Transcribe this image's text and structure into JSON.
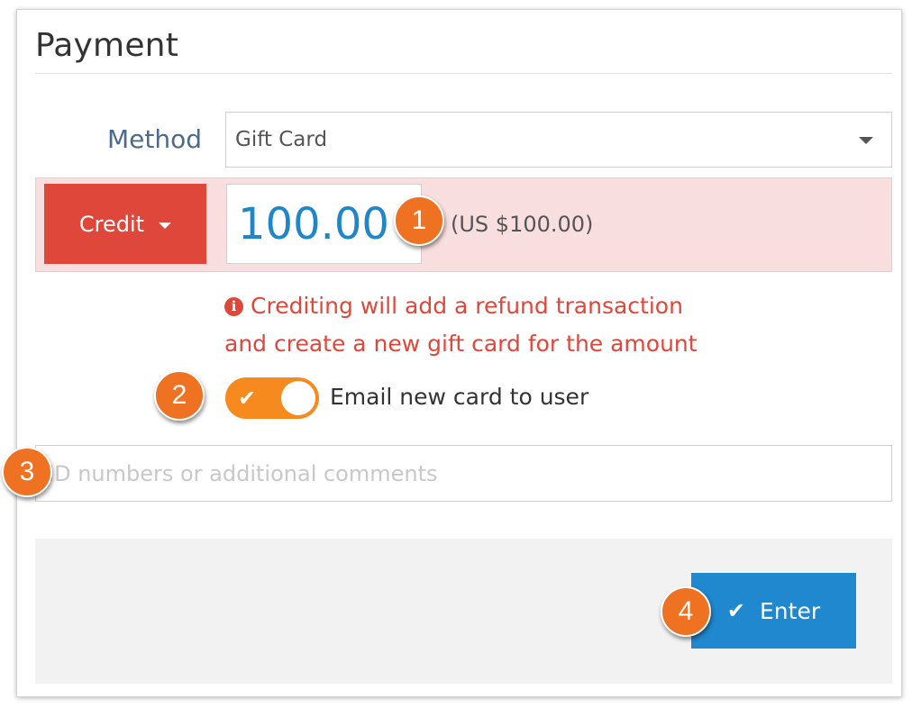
{
  "header": {
    "title": "Payment"
  },
  "method": {
    "label": "Method",
    "selected": "Gift Card"
  },
  "amount": {
    "type_button_label": "Credit",
    "value": "100.00",
    "converted": "(US $100.00)"
  },
  "warning": {
    "icon": "info-icon",
    "line1": "Crediting will add a refund transaction",
    "line2": "and create a new gift card for the amount"
  },
  "email_toggle": {
    "label": "Email new card to user",
    "on": true
  },
  "comments": {
    "placeholder": "ID numbers or additional comments",
    "value": ""
  },
  "footer": {
    "enter_label": "Enter"
  },
  "callouts": [
    "1",
    "2",
    "3",
    "4"
  ],
  "colors": {
    "accent_orange": "#ee7222",
    "credit_red": "#e0473b",
    "enter_blue": "#1f88cf",
    "toggle_orange": "#f78a1e",
    "amount_blue": "#1f86c8"
  }
}
